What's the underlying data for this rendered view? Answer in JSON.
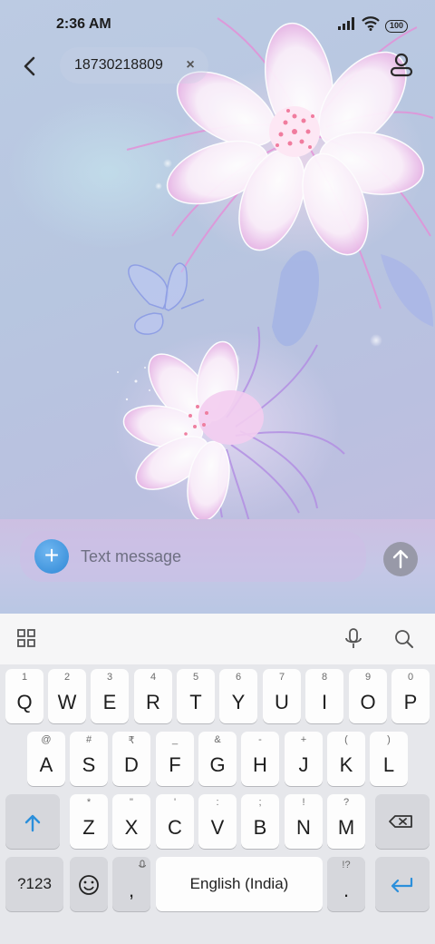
{
  "status_bar": {
    "time": "2:36 AM",
    "battery": "100"
  },
  "header": {
    "recipient": "18730218809",
    "clear_glyph": "×"
  },
  "compose": {
    "placeholder": "Text message",
    "add_glyph": "+"
  },
  "keyboard": {
    "toolbar_icons": [
      "grid-icon",
      "microphone-icon",
      "search-icon"
    ],
    "row1": [
      {
        "key": "Q",
        "alt": "1"
      },
      {
        "key": "W",
        "alt": "2"
      },
      {
        "key": "E",
        "alt": "3"
      },
      {
        "key": "R",
        "alt": "4"
      },
      {
        "key": "T",
        "alt": "5"
      },
      {
        "key": "Y",
        "alt": "6"
      },
      {
        "key": "U",
        "alt": "7"
      },
      {
        "key": "I",
        "alt": "8"
      },
      {
        "key": "O",
        "alt": "9"
      },
      {
        "key": "P",
        "alt": "0"
      }
    ],
    "row2": [
      {
        "key": "A",
        "alt": "@"
      },
      {
        "key": "S",
        "alt": "#"
      },
      {
        "key": "D",
        "alt": "₹"
      },
      {
        "key": "F",
        "alt": "_"
      },
      {
        "key": "G",
        "alt": "&"
      },
      {
        "key": "H",
        "alt": "-"
      },
      {
        "key": "J",
        "alt": "+"
      },
      {
        "key": "K",
        "alt": "("
      },
      {
        "key": "L",
        "alt": ")"
      }
    ],
    "row3": [
      {
        "key": "Z",
        "alt": "*"
      },
      {
        "key": "X",
        "alt": "\""
      },
      {
        "key": "C",
        "alt": "'"
      },
      {
        "key": "V",
        "alt": ":"
      },
      {
        "key": "B",
        "alt": ";"
      },
      {
        "key": "N",
        "alt": "!"
      },
      {
        "key": "M",
        "alt": "?"
      }
    ],
    "symbols_label": "?123",
    "comma": ",",
    "space_label": "English (India)",
    "period": ".",
    "period_alt": "!?"
  }
}
